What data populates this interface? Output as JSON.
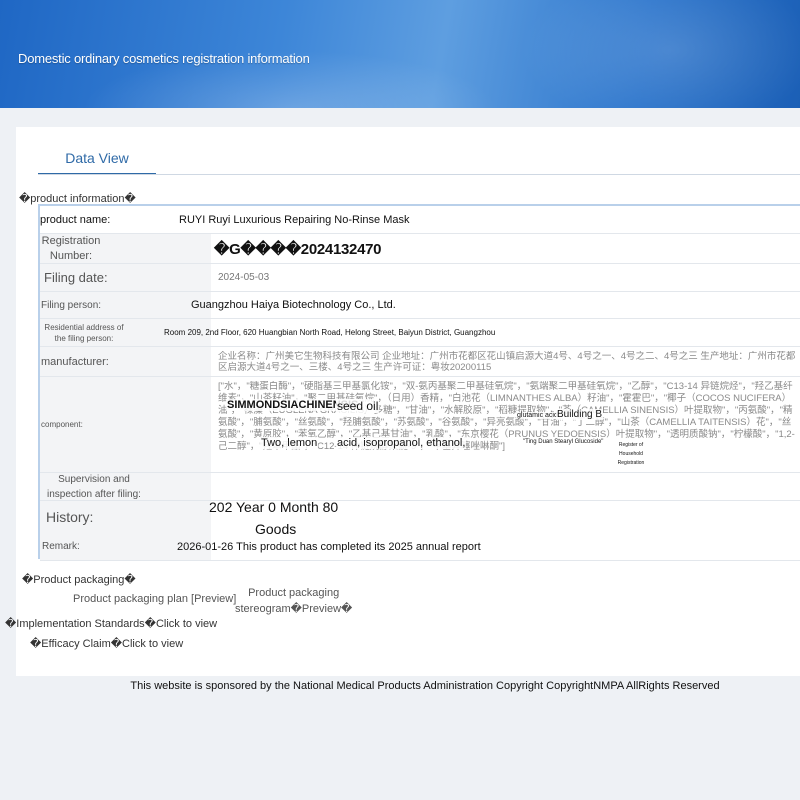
{
  "header": {
    "title": "Domestic ordinary cosmetics registration information"
  },
  "tabs": {
    "data_view": "Data View"
  },
  "sections": {
    "product_info": "�product information�",
    "product_packaging": "�Product packaging�"
  },
  "product": {
    "name_label": "product name:",
    "name_value": "RUYI Ruyi Luxurious Repairing No-Rinse Mask",
    "reg_label": "Registration Number:",
    "reg_value": "�G����2024132470",
    "filing_date_label": "Filing date:",
    "filing_date_value": "2024-05-03",
    "filing_person_label": "Filing person:",
    "filing_person_value": "Guangzhou Haiya Biotechnology Co., Ltd.",
    "address_label": "Residential address of the filing person:",
    "address_value": "Room 209, 2nd Floor, 620 Huangbian North Road, Helong Street, Baiyun District, Guangzhou",
    "manufacturer_label": "manufacturer:",
    "manufacturer_value": "企业名称：广州美它生物科技有限公司 企业地址：广州市花都区花山镇启源大道4号、4号之一、4号之二、4号之三 生产地址：广州市花都区启源大道4号之一、三楼、4号之三 生产许可证：粤妆20200115",
    "component_label": "component:",
    "component_text": "[\"水\"，\"糖蛋白酶\"，\"硬脂基三甲基氯化铵\"，\"双-氨丙基聚二甲基硅氧烷\"，\"氨端聚二甲基硅氧烷\"，\"乙醇\"，\"C13-14 异链烷烃\"，\"羟乙基纤维素\"，\"山茶籽油\"，\"聚二甲基硅氧烷\"，（日用）香精，\"白池花（LIMNANTHES ALBA）籽油\"，\"霍霍巴\"，\"椰子（COCOS NUCIFERA）油\"，\"裸藻（EUGLENA GRACILIS）多糖\"，\"甘油\"，\"水解胶原\"，\"稻糠提取物\"，\"茶（CAMELLIA SINENSIS）叶提取物\"，\"丙氨酸\"，\"精氨酸\"，\"脯氨酸\"，\"丝氨酸\"，\"羟脯氨酸\"，\"苏氨酸\"，\"谷氨酸\"，\"异亮氨酸\"，\"甘油\"，\"丁二醇\"，\"山茶（CAMELLIA TAITENSIS）花\"，\"丝氨酸\"，\"黄原胶\"，\"苯氧乙醇\"，\"乙基己基甘油\"，\"乳酸\"，\"东京樱花（PRUNUS YEDOENSIS）叶提取物\"，\"透明质酸钠\"，\"柠檬酸\"，\"1,2-己二醇\"，\"羟苯甲酯\"，\"C12-14 仲链烷醇聚醚-9\"，\"甲基异噻唑啉酮\"]",
    "component_overlays": {
      "simmondsia": "SIMMONDSIACHINENSIS",
      "seed_oil": "seed oil",
      "glutamic": "glutamic acid",
      "building": "Building B",
      "two_lemon": "Two, lemon",
      "acid_iso": "acid, isopropanol, ethanol,",
      "ting_duan": "\"Ting Duan Stearyl Glucoside\"",
      "household_reg": "Register of Household Registration"
    },
    "supervision_label": "Supervision and inspection after filing:",
    "history_label": "History:",
    "history_value": "202 Year 0 Month 80",
    "history_goods": "Goods",
    "remark_label": "Remark:",
    "remark_value": "2026-01-26 This product has completed its 2025 annual report"
  },
  "packaging": {
    "plan_link": "Product packaging plan [Preview]",
    "stereo_line1": "Product packaging",
    "stereo_line2": "stereogram�Preview�",
    "implementation": "�Implementation Standards�Click to view",
    "efficacy": "�Efficacy Claim�Click to view"
  },
  "footer": {
    "text": "This website is sponsored by the National Medical Products Administration Copyright CopyrightNMPA AllRights Reserved"
  },
  "colors": {
    "banner_start": "#1f67c4",
    "banner_end": "#1b5fb6",
    "tab_accent": "#2f6aa7",
    "table_border": "#b9d0ea",
    "label_bg": "#f3f4f6"
  }
}
